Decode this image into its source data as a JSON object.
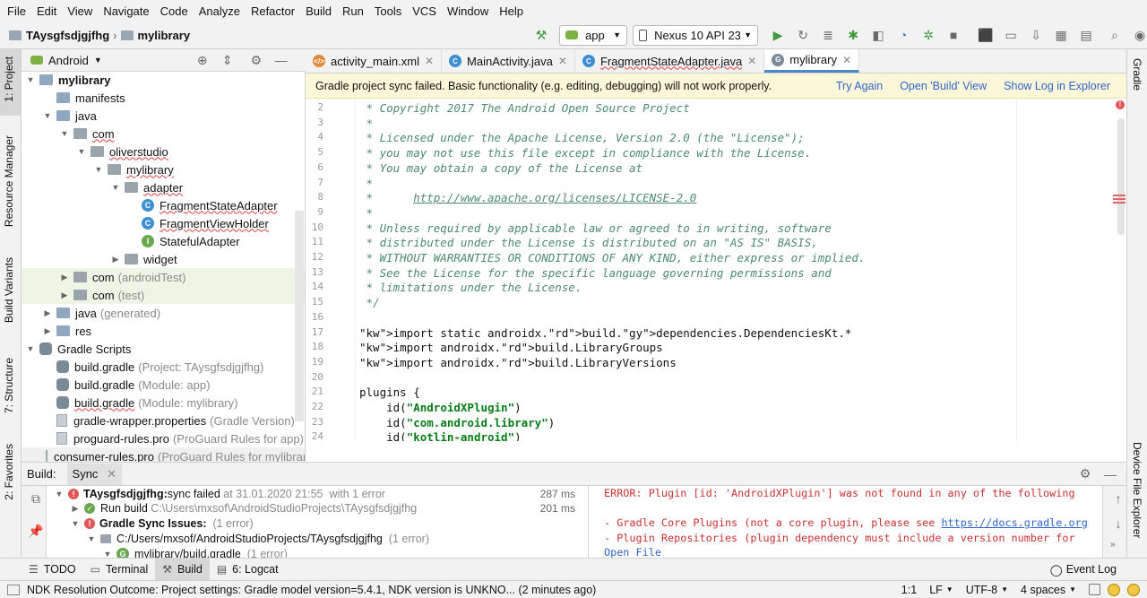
{
  "menu": [
    "File",
    "Edit",
    "View",
    "Navigate",
    "Code",
    "Analyze",
    "Refactor",
    "Build",
    "Run",
    "Tools",
    "VCS",
    "Window",
    "Help"
  ],
  "breadcrumb": {
    "project": "TAysgfsdjgjfhg",
    "module": "mylibrary"
  },
  "toolbar": {
    "config": "app",
    "device": "Nexus 10 API 23"
  },
  "left_strip": {
    "project": "1: Project",
    "resource_manager": "Resource Manager",
    "build_variants": "Build Variants",
    "structure": "7: Structure",
    "favorites": "2: Favorites"
  },
  "right_strip": {
    "gradle": "Gradle",
    "device_explorer": "Device File Explorer"
  },
  "project_panel": {
    "view": "Android"
  },
  "tree": [
    {
      "label": "mylibrary",
      "note": ""
    },
    {
      "label": "manifests",
      "note": ""
    },
    {
      "label": "java",
      "note": ""
    },
    {
      "label": "com",
      "note": ""
    },
    {
      "label": "oliverstudio",
      "note": ""
    },
    {
      "label": "mylibrary",
      "note": ""
    },
    {
      "label": "adapter",
      "note": ""
    },
    {
      "label": "FragmentStateAdapter",
      "note": ""
    },
    {
      "label": "FragmentViewHolder",
      "note": ""
    },
    {
      "label": "StatefulAdapter",
      "note": ""
    },
    {
      "label": "widget",
      "note": ""
    },
    {
      "label": "com",
      "note": "(androidTest)"
    },
    {
      "label": "com",
      "note": "(test)"
    },
    {
      "label": "java",
      "note": "(generated)"
    },
    {
      "label": "res",
      "note": ""
    },
    {
      "label": "Gradle Scripts",
      "note": ""
    },
    {
      "label": "build.gradle",
      "note": "(Project: TAysgfsdjgjfhg)"
    },
    {
      "label": "build.gradle",
      "note": "(Module: app)"
    },
    {
      "label": "build.gradle",
      "note": "(Module: mylibrary)"
    },
    {
      "label": "gradle-wrapper.properties",
      "note": "(Gradle Version)"
    },
    {
      "label": "proguard-rules.pro",
      "note": "(ProGuard Rules for app)"
    },
    {
      "label": "consumer-rules.pro",
      "note": "(ProGuard Rules for mylibrar"
    }
  ],
  "tabs": [
    "activity_main.xml",
    "MainActivity.java",
    "FragmentStateAdapter.java",
    "mylibrary"
  ],
  "banner": {
    "message": "Gradle project sync failed. Basic functionality (e.g. editing, debugging) will not work properly.",
    "try_again": "Try Again",
    "open_build": "Open 'Build' View",
    "show_log": "Show Log in Explorer"
  },
  "code": [
    {
      "n": "2",
      "t": " * Copyright 2017 The Android Open Source Project"
    },
    {
      "n": "3",
      "t": " *"
    },
    {
      "n": "4",
      "t": " * Licensed under the Apache License, Version 2.0 (the \"License\");"
    },
    {
      "n": "5",
      "t": " * you may not use this file except in compliance with the License."
    },
    {
      "n": "6",
      "t": " * You may obtain a copy of the License at"
    },
    {
      "n": "7",
      "t": " *"
    },
    {
      "n": "8",
      "t": " *      http://www.apache.org/licenses/LICENSE-2.0"
    },
    {
      "n": "9",
      "t": " *"
    },
    {
      "n": "10",
      "t": " * Unless required by applicable law or agreed to in writing, software"
    },
    {
      "n": "11",
      "t": " * distributed under the License is distributed on an \"AS IS\" BASIS,"
    },
    {
      "n": "12",
      "t": " * WITHOUT WARRANTIES OR CONDITIONS OF ANY KIND, either express or implied."
    },
    {
      "n": "13",
      "t": " * See the License for the specific language governing permissions and"
    },
    {
      "n": "14",
      "t": " * limitations under the License."
    },
    {
      "n": "15",
      "t": " */"
    },
    {
      "n": "16",
      "t": ""
    },
    {
      "n": "17",
      "t": "import static androidx.build.dependencies.DependenciesKt.*"
    },
    {
      "n": "18",
      "t": "import androidx.build.LibraryGroups"
    },
    {
      "n": "19",
      "t": "import androidx.build.LibraryVersions"
    },
    {
      "n": "20",
      "t": ""
    },
    {
      "n": "21",
      "t": "plugins {"
    },
    {
      "n": "22",
      "t": "    id(\"AndroidXPlugin\")"
    },
    {
      "n": "23",
      "t": "    id(\"com.android.library\")"
    },
    {
      "n": "24",
      "t": "    id(\"kotlin-android\")"
    }
  ],
  "build_panel": {
    "title": "Build:",
    "tab": "Sync"
  },
  "build_tree": [
    {
      "bold": "TAysgfsdjgjfhg:",
      "text": " sync failed",
      "grey": " at 31.01.2020 21:55  with 1 error",
      "ms": "287 ms"
    },
    {
      "bold": "",
      "text": "Run build",
      "grey": " C:\\Users\\mxsof\\AndroidStudioProjects\\TAysgfsdjgjfhg",
      "ms": "201 ms"
    },
    {
      "bold": "Gradle Sync Issues:",
      "text": "",
      "grey": "  (1 error)",
      "ms": ""
    },
    {
      "bold": "",
      "text": "C:/Users/mxsof/AndroidStudioProjects/TAysgfsdjgjfhg",
      "grey": "  (1 error)",
      "ms": ""
    },
    {
      "bold": "",
      "text": "mylibrary/build.gradle",
      "grey": "  (1 error)",
      "ms": ""
    }
  ],
  "build_output": [
    "ERROR: Plugin [id: 'AndroidXPlugin'] was not found in any of the following",
    "",
    "- Gradle Core Plugins (not a core plugin, please see https://docs.gradle.org",
    "- Plugin Repositories (plugin dependency must include a version number for",
    "Open File"
  ],
  "bottom_tabs": [
    "TODO",
    "Terminal",
    "Build",
    "6: Logcat"
  ],
  "event_log": "Event Log",
  "status": {
    "message": "NDK Resolution Outcome: Project settings: Gradle model version=5.4.1, NDK version is UNKNO... (2 minutes ago)",
    "pos": "1:1",
    "lf": "LF",
    "enc": "UTF-8",
    "indent": "4 spaces"
  }
}
